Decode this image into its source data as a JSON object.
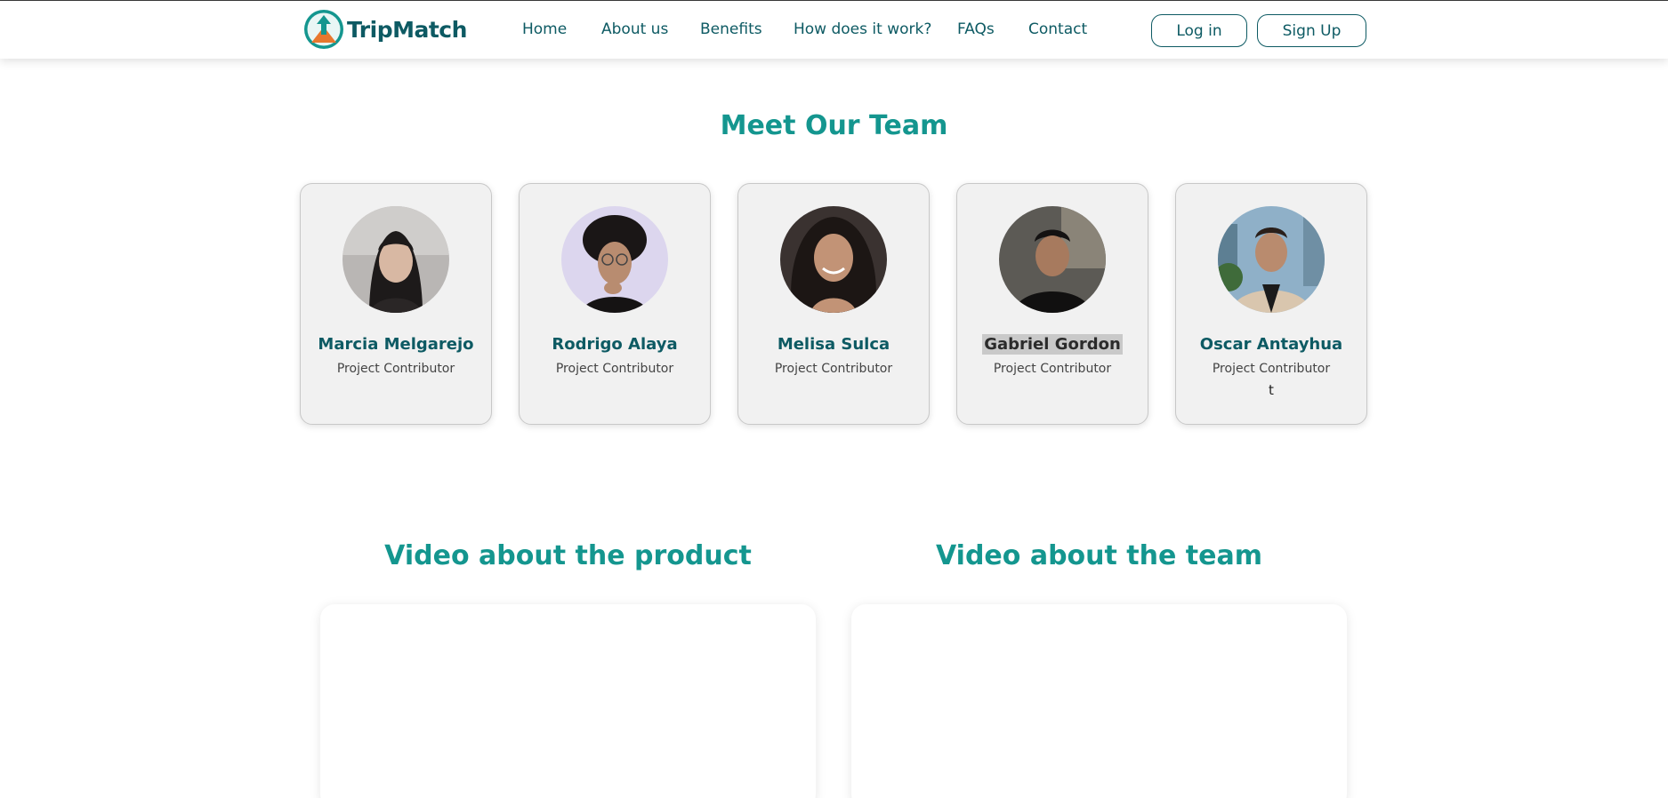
{
  "brand": {
    "name": "TripMatch",
    "accent": "#14968f",
    "dark": "#0d5a63",
    "orange": "#e8772e"
  },
  "nav": {
    "items": [
      {
        "label": "Home"
      },
      {
        "label": "About us"
      },
      {
        "label": "Benefits"
      },
      {
        "label": "How does it work?"
      },
      {
        "label": "FAQs"
      },
      {
        "label": "Contact"
      }
    ],
    "login_label": "Log in",
    "signup_label": "Sign Up"
  },
  "team": {
    "title": "Meet Our Team",
    "members": [
      {
        "name": "Marcia Melgarejo",
        "role": "Project Contributor",
        "extra": ""
      },
      {
        "name": "Rodrigo Alaya",
        "role": "Project Contributor",
        "extra": ""
      },
      {
        "name": "Melisa Sulca",
        "role": "Project Contributor",
        "extra": ""
      },
      {
        "name": "Gabriel Gordon",
        "role": "Project Contributor",
        "extra": ""
      },
      {
        "name": "Oscar Antayhua",
        "role": "Project Contributor",
        "extra": "t"
      }
    ]
  },
  "videos": {
    "product_title": "Video about the product",
    "team_title": "Video about the team"
  }
}
